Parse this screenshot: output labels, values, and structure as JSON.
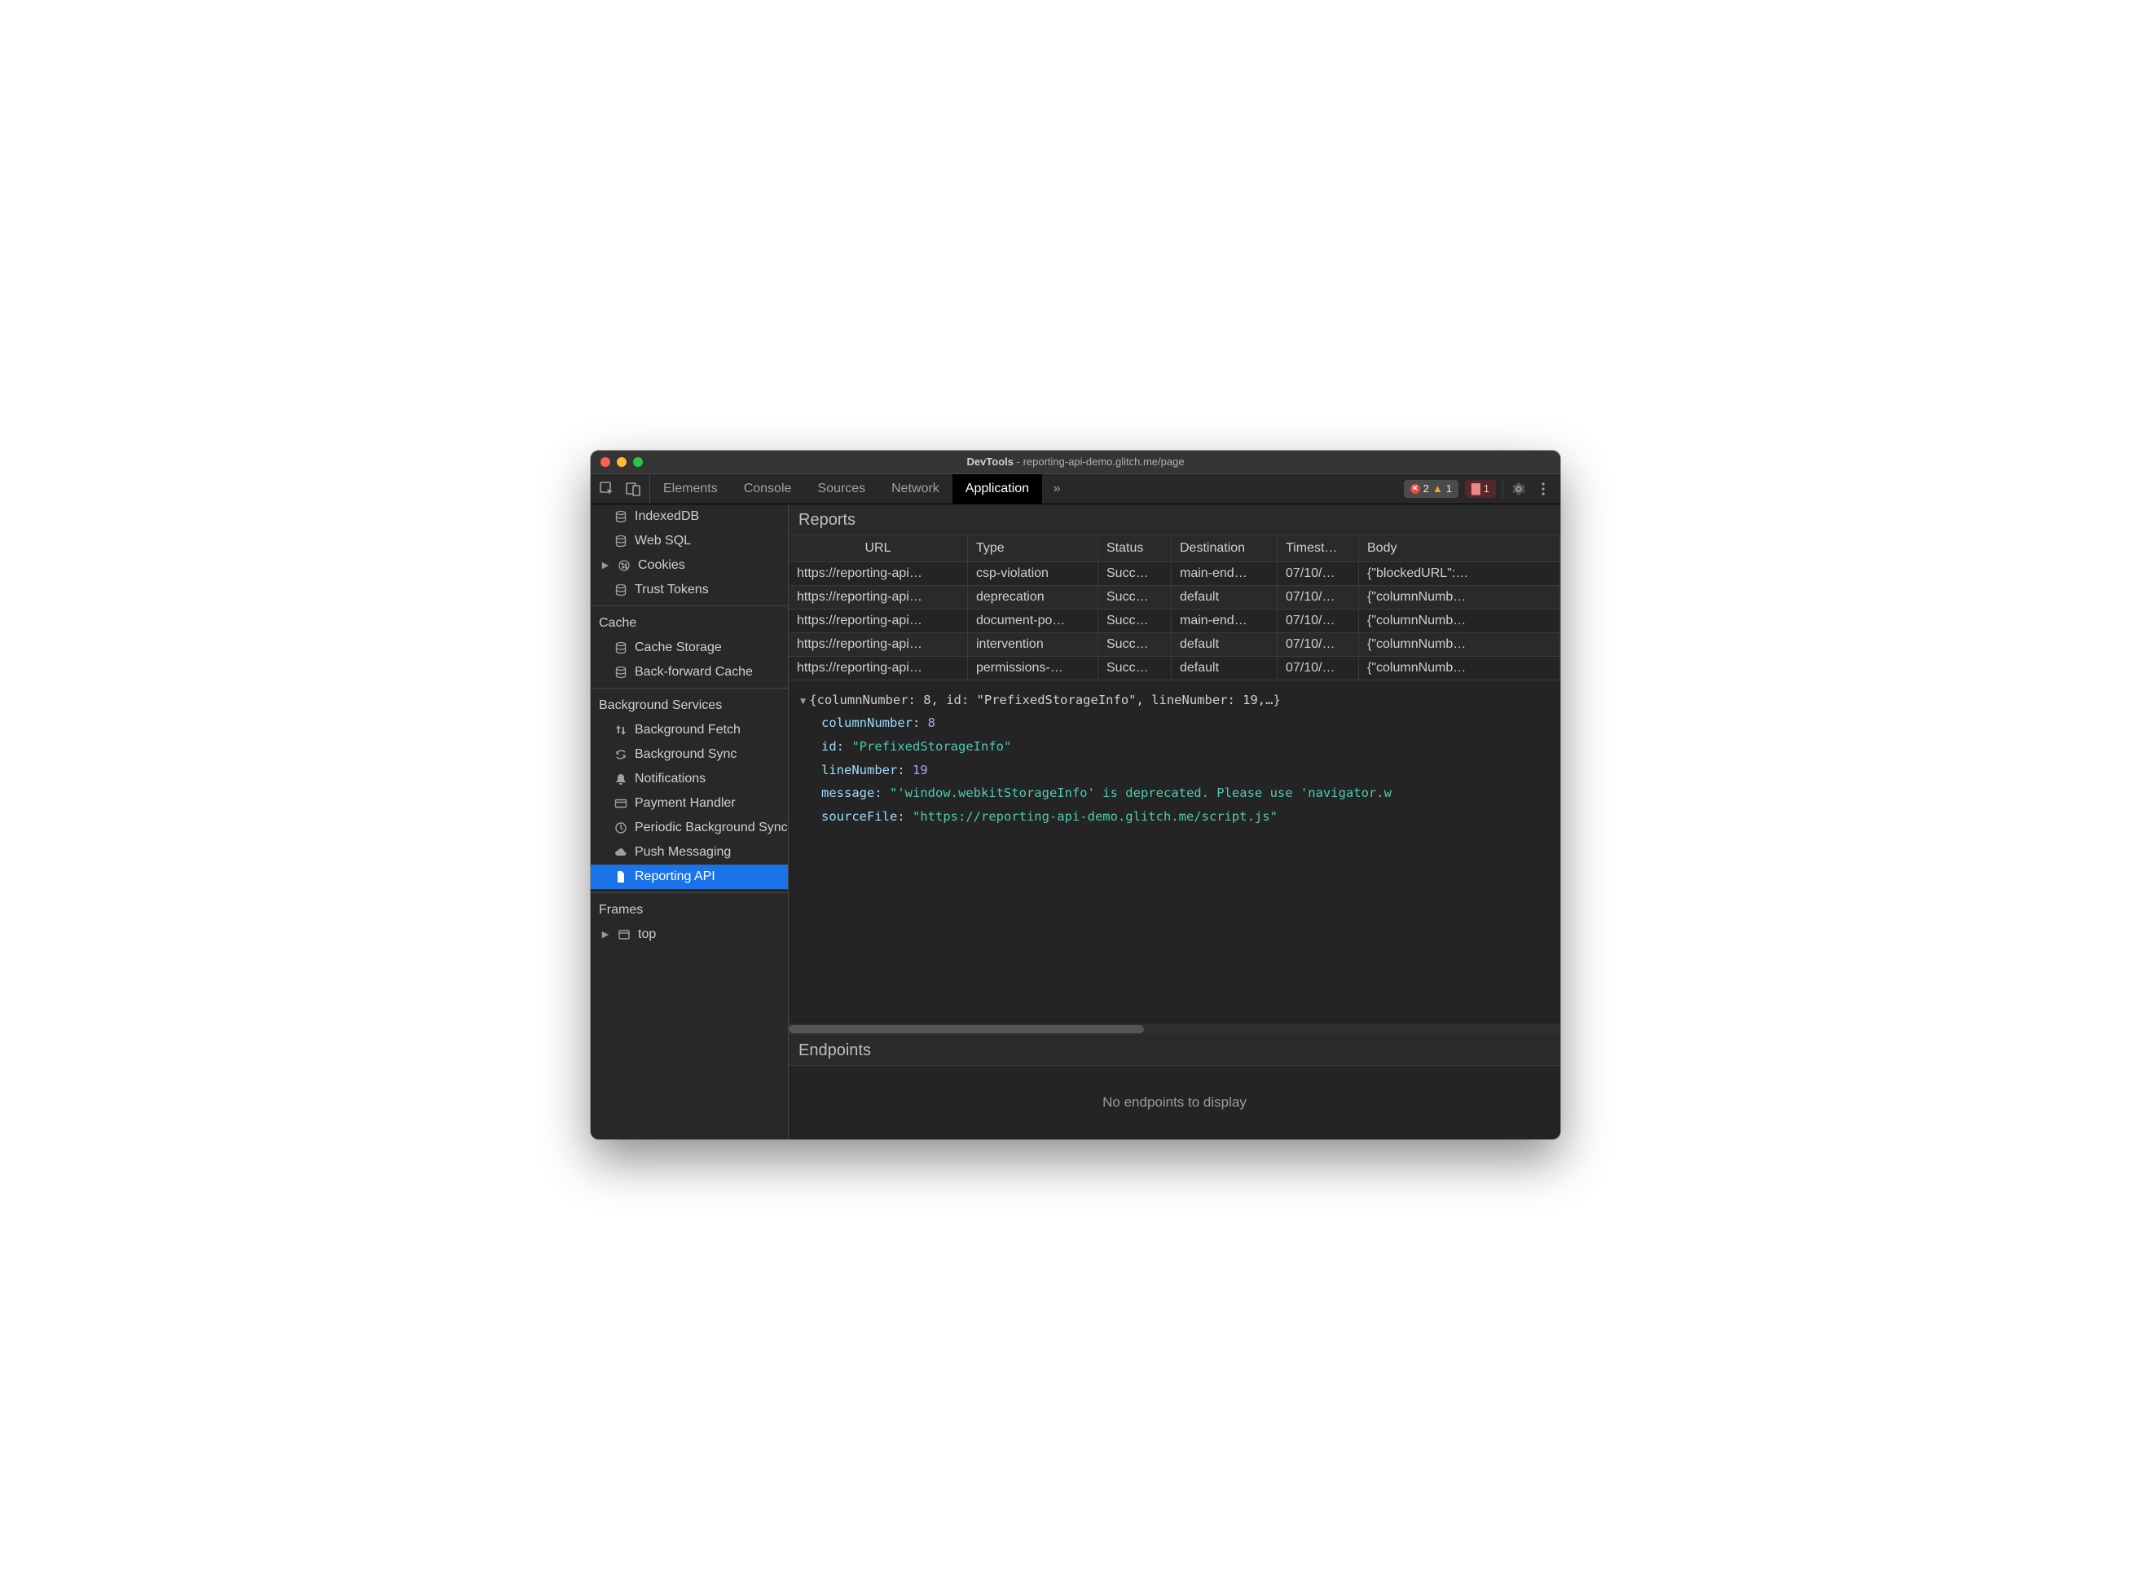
{
  "window": {
    "title_prefix": "DevTools",
    "title_path": "reporting-api-demo.glitch.me/page"
  },
  "toolbar": {
    "tabs": [
      "Elements",
      "Console",
      "Sources",
      "Network",
      "Application"
    ],
    "active_tab": "Application",
    "errors": "2",
    "warnings": "1",
    "issues": "1"
  },
  "sidebar": {
    "storage_items": [
      {
        "label": "IndexedDB",
        "icon": "db",
        "expandable": false
      },
      {
        "label": "Web SQL",
        "icon": "db",
        "expandable": false
      },
      {
        "label": "Cookies",
        "icon": "cookie",
        "expandable": true
      },
      {
        "label": "Trust Tokens",
        "icon": "db",
        "expandable": false
      }
    ],
    "cache": {
      "title": "Cache",
      "items": [
        {
          "label": "Cache Storage",
          "icon": "db"
        },
        {
          "label": "Back-forward Cache",
          "icon": "db"
        }
      ]
    },
    "bg": {
      "title": "Background Services",
      "items": [
        {
          "label": "Background Fetch",
          "icon": "updown"
        },
        {
          "label": "Background Sync",
          "icon": "sync"
        },
        {
          "label": "Notifications",
          "icon": "bell"
        },
        {
          "label": "Payment Handler",
          "icon": "card"
        },
        {
          "label": "Periodic Background Sync",
          "icon": "clock"
        },
        {
          "label": "Push Messaging",
          "icon": "cloud"
        },
        {
          "label": "Reporting API",
          "icon": "file",
          "selected": true
        }
      ]
    },
    "frames": {
      "title": "Frames",
      "items": [
        {
          "label": "top",
          "icon": "frame",
          "expandable": true
        }
      ]
    }
  },
  "reports": {
    "title": "Reports",
    "headers": [
      "URL",
      "Type",
      "Status",
      "Destination",
      "Timest…",
      "Body"
    ],
    "rows": [
      {
        "url": "https://reporting-api…",
        "type": "csp-violation",
        "status": "Succ…",
        "dest": "main-end…",
        "ts": "07/10/…",
        "body": "{\"blockedURL\":…"
      },
      {
        "url": "https://reporting-api…",
        "type": "deprecation",
        "status": "Succ…",
        "dest": "default",
        "ts": "07/10/…",
        "body": "{\"columnNumb…"
      },
      {
        "url": "https://reporting-api…",
        "type": "document-po…",
        "status": "Succ…",
        "dest": "main-end…",
        "ts": "07/10/…",
        "body": "{\"columnNumb…"
      },
      {
        "url": "https://reporting-api…",
        "type": "intervention",
        "status": "Succ…",
        "dest": "default",
        "ts": "07/10/…",
        "body": "{\"columnNumb…"
      },
      {
        "url": "https://reporting-api…",
        "type": "permissions-…",
        "status": "Succ…",
        "dest": "default",
        "ts": "07/10/…",
        "body": "{\"columnNumb…"
      }
    ]
  },
  "detail": {
    "head": "{columnNumber: 8, id: \"PrefixedStorageInfo\", lineNumber: 19,…}",
    "fields": {
      "columnNumber_k": "columnNumber:",
      "columnNumber_v": "8",
      "id_k": "id:",
      "id_v": "\"PrefixedStorageInfo\"",
      "lineNumber_k": "lineNumber:",
      "lineNumber_v": "19",
      "message_k": "message:",
      "message_v": "\"'window.webkitStorageInfo' is deprecated. Please use 'navigator.w",
      "sourceFile_k": "sourceFile:",
      "sourceFile_v": "\"https://reporting-api-demo.glitch.me/script.js\""
    }
  },
  "endpoints": {
    "title": "Endpoints",
    "empty": "No endpoints to display"
  }
}
